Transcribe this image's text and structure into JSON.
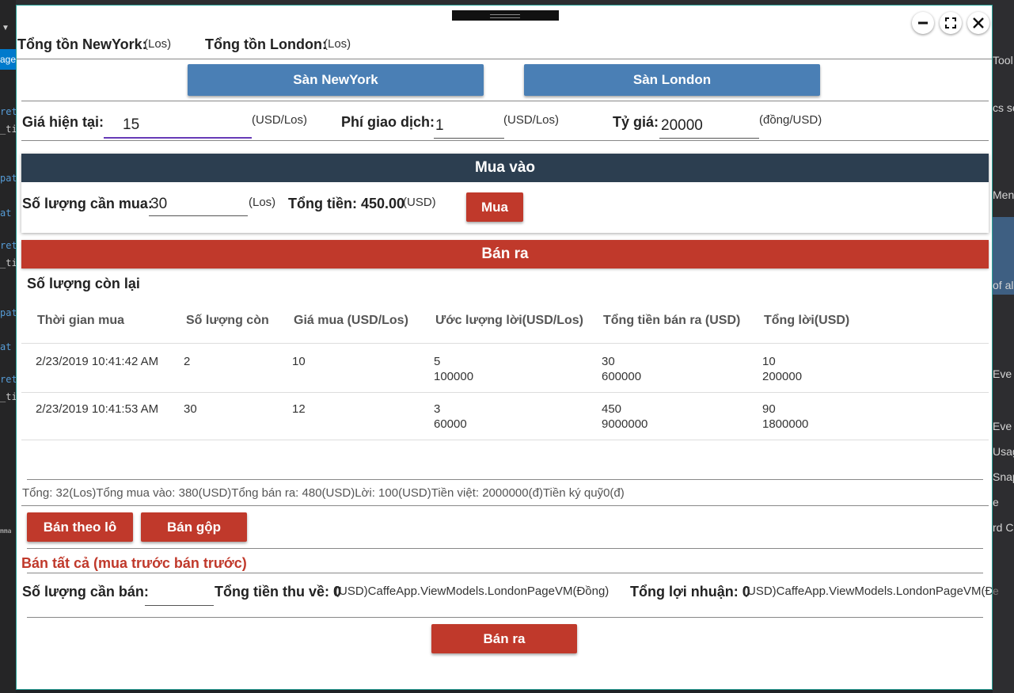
{
  "background": {
    "left_tab": "age",
    "left_code": [
      "ret",
      "_ti",
      "pat",
      "at",
      "ret",
      "_ti",
      "pat",
      "at",
      "ret",
      "_ti"
    ],
    "left_mm": "mma",
    "right_items": [
      "Tool",
      "cs se",
      "Men",
      "of al",
      "Eve",
      "Eve",
      "Usag",
      "Snap",
      "e",
      "rd C",
      "e"
    ]
  },
  "window": {
    "controls": {
      "minimize": "minimize",
      "maximize": "maximize",
      "close": "close"
    }
  },
  "stock": {
    "newyork_label": "Tổng tồn NewYork:",
    "newyork_unit": "(Los)",
    "london_label": "Tổng tồn London:",
    "london_unit": "(Los)"
  },
  "exchanges": {
    "newyork_button": "Sàn NewYork",
    "london_button": "Sàn London"
  },
  "pricing": {
    "price_label": "Giá hiện tại:",
    "price_value": "15",
    "price_unit": "(USD/Los)",
    "fee_label": "Phí giao dịch:",
    "fee_value": "1",
    "fee_unit": "(USD/Los)",
    "rate_label": "Tỷ giá:",
    "rate_value": "20000",
    "rate_unit": "(đồng/USD)"
  },
  "buy": {
    "title": "Mua vào",
    "qty_label": "Số lượng cần mua:",
    "qty_value": "30",
    "qty_unit": "(Los)",
    "total_label": "Tổng tiền: 450.00",
    "total_unit": "(USD)",
    "button": "Mua",
    "header_color": "#2c3e50"
  },
  "sell": {
    "title": "Bán ra",
    "remaining_label": "Số lượng còn lại",
    "header_color": "#c0392b",
    "columns": [
      "Thời gian mua",
      "Số lượng còn",
      "Giá mua (USD/Los)",
      "Ước lượng lời(USD/Los)",
      "Tổng tiền bán ra (USD)",
      "Tổng lời(USD)"
    ],
    "rows": [
      {
        "time": "2/23/2019 10:41:42 AM",
        "qty": "2",
        "price": "10",
        "est_a": "5",
        "est_b": "100000",
        "total_a": "30",
        "total_b": "600000",
        "profit_a": "10",
        "profit_b": "200000"
      },
      {
        "time": "2/23/2019 10:41:53 AM",
        "qty": "30",
        "price": "12",
        "est_a": "3",
        "est_b": "60000",
        "total_a": "450",
        "total_b": "9000000",
        "profit_a": "90",
        "profit_b": "1800000"
      }
    ],
    "summary": "Tổng: 32(Los)Tổng mua vào: 380(USD)Tổng bán ra: 480(USD)Lời: 100(USD)Tiền việt: 2000000(đ)Tiền ký quỹ0(đ)",
    "sell_by_lot_button": "Bán theo lô",
    "sell_merged_button": "Bán gộp",
    "sell_all_title": "Bán tất cả (mua trước bán trước)",
    "sell_qty_label": "Số lượng cần bán:",
    "sell_qty_value": "",
    "collect_label": "Tổng tiền thu về: 0",
    "collect_unit": "(USD)CaffeApp.ViewModels.LondonPageVM(Đồng)",
    "profit_label": "Tổng lợi nhuận: 0",
    "profit_unit": "(USD)CaffeApp.ViewModels.LondonPageVM(Đồng)",
    "sell_button": "Bán ra"
  }
}
